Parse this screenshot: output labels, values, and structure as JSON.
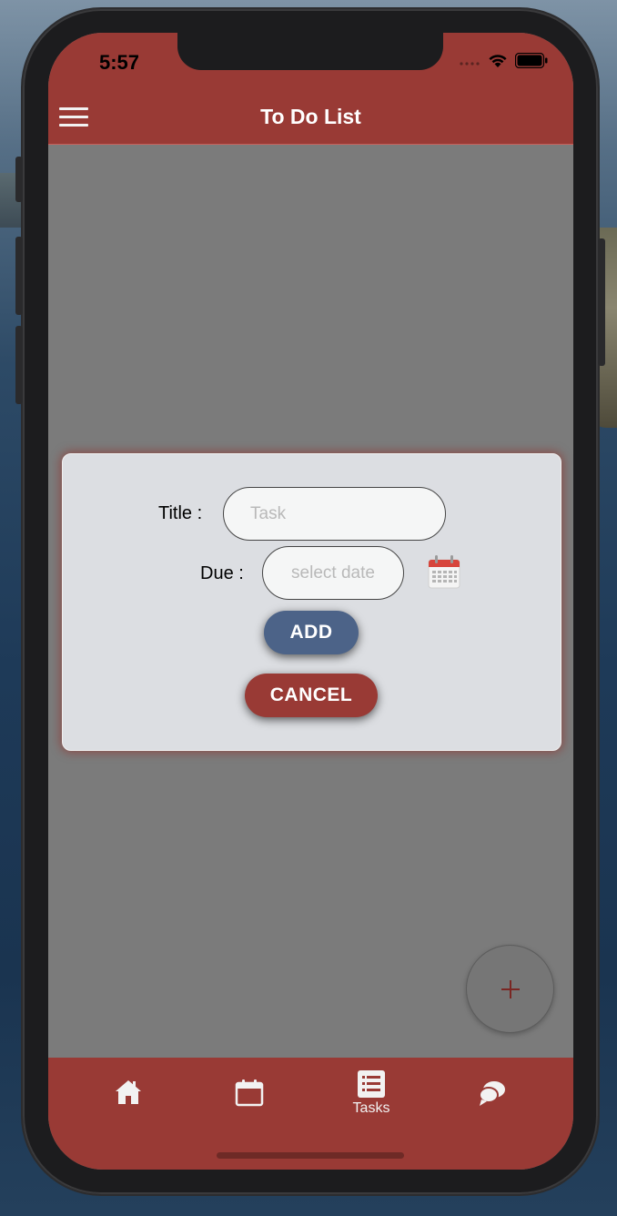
{
  "status_bar": {
    "time": "5:57"
  },
  "header": {
    "title": "To Do List"
  },
  "dialog": {
    "title_label": "Title :",
    "title_placeholder": "Task",
    "due_label": "Due :",
    "due_placeholder": "select date",
    "add_label": "ADD",
    "cancel_label": "CANCEL"
  },
  "fab": {
    "icon": "plus-icon"
  },
  "tabbar": {
    "items": [
      {
        "icon": "home-icon",
        "label": ""
      },
      {
        "icon": "calendar-icon",
        "label": ""
      },
      {
        "icon": "list-icon",
        "label": "Tasks"
      },
      {
        "icon": "chat-icon",
        "label": ""
      }
    ]
  },
  "colors": {
    "primary": "#993a35",
    "add_button": "#4c6388",
    "overlay": "#7b7b7b",
    "dialog_bg": "#dcdee2"
  }
}
